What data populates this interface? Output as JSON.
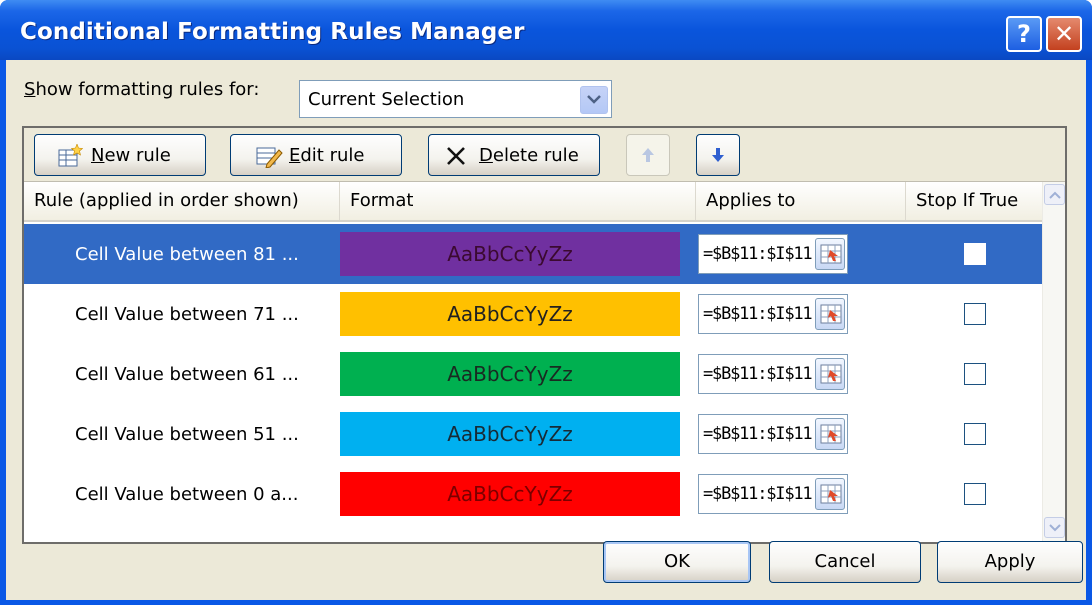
{
  "window": {
    "title": "Conditional Formatting Rules Manager",
    "help_glyph": "?",
    "close_glyph": "✕"
  },
  "show_rules": {
    "label_prefix": "S",
    "label_rest": "how formatting rules for:",
    "selected": "Current Selection"
  },
  "toolbar": {
    "new_rule": {
      "key": "N",
      "rest": "ew rule"
    },
    "edit_rule": {
      "key": "E",
      "rest": "dit rule"
    },
    "delete_rule": {
      "key": "D",
      "rest": "elete rule"
    },
    "move_up_icon": "arrow-up-icon",
    "move_down_icon": "arrow-down-icon"
  },
  "columns": [
    "Rule (applied in order shown)",
    "Format",
    "Applies to",
    "Stop If True"
  ],
  "rules": [
    {
      "rule": "Cell Value between 81 ...",
      "sample": "AaBbCcYyZz",
      "bg": "#7030a0",
      "fg": "#3b0a2f",
      "applies_to": "=$B$11:$I$11",
      "stop_if_true": false,
      "selected": true
    },
    {
      "rule": "Cell Value between 71 ...",
      "sample": "AaBbCcYyZz",
      "bg": "#ffc000",
      "fg": "#222222",
      "applies_to": "=$B$11:$I$11",
      "stop_if_true": false,
      "selected": false
    },
    {
      "rule": "Cell Value between 61 ...",
      "sample": "AaBbCcYyZz",
      "bg": "#00b050",
      "fg": "#1a2a22",
      "applies_to": "=$B$11:$I$11",
      "stop_if_true": false,
      "selected": false
    },
    {
      "rule": "Cell Value between 51 ...",
      "sample": "AaBbCcYyZz",
      "bg": "#00b0f0",
      "fg": "#1a2a35",
      "applies_to": "=$B$11:$I$11",
      "stop_if_true": false,
      "selected": false
    },
    {
      "rule": "Cell Value between 0 a...",
      "sample": "AaBbCcYyZz",
      "bg": "#ff0000",
      "fg": "#7a0000",
      "applies_to": "=$B$11:$I$11",
      "stop_if_true": false,
      "selected": false
    }
  ],
  "footer": {
    "ok": "OK",
    "cancel": "Cancel",
    "apply": "Apply"
  },
  "colors": {
    "titlebar": "#0a55dc",
    "dialog_bg": "#ece9d8",
    "selection": "#316ac5"
  }
}
